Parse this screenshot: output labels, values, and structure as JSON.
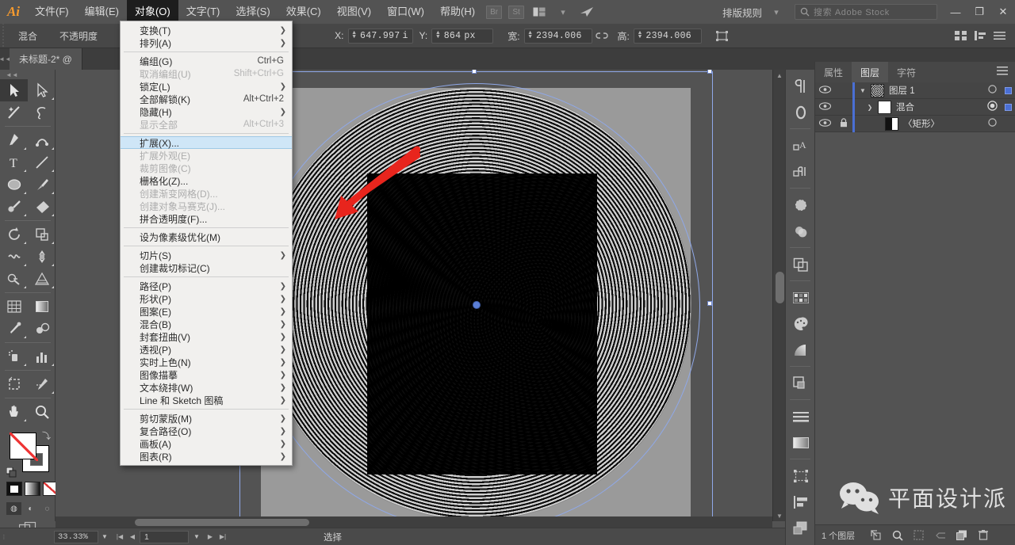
{
  "app": {
    "logo": "Ai"
  },
  "menubar": {
    "items": [
      {
        "label": "文件(F)",
        "active": false
      },
      {
        "label": "编辑(E)",
        "active": false
      },
      {
        "label": "对象(O)",
        "active": true
      },
      {
        "label": "文字(T)",
        "active": false
      },
      {
        "label": "选择(S)",
        "active": false
      },
      {
        "label": "效果(C)",
        "active": false
      },
      {
        "label": "视图(V)",
        "active": false
      },
      {
        "label": "窗口(W)",
        "active": false
      },
      {
        "label": "帮助(H)",
        "active": false
      }
    ],
    "bridge_badge": "Br",
    "stock_badge": "St",
    "arrange_icon": "arrange-documents-icon",
    "share_icon": "share-icon",
    "workspace": "排版规则",
    "search_placeholder": "搜索 Adobe Stock",
    "window_minimize": "—",
    "window_restore": "❐",
    "window_close": "✕"
  },
  "controlbar": {
    "object_type": "混合",
    "opacity_label": "不透明度",
    "x_label": "X:",
    "x_value": "647.997",
    "x_unit": "i",
    "y_label": "Y:",
    "y_value": "864",
    "y_unit": "px",
    "w_label": "宽:",
    "w_value": "2394.006",
    "link_icon": "broken-link-icon",
    "h_label": "高:",
    "h_value": "2394.006",
    "transform_icon": "transform-icon",
    "arrange_icon": "arrange-icon",
    "align_icon": "align-icon",
    "menu_icon": "panel-menu-icon"
  },
  "tabbar": {
    "document_title": "未标题-2* @"
  },
  "menu_dropdown": {
    "items": [
      {
        "label": "变换(T)",
        "key": "",
        "sub": true,
        "disabled": false,
        "highlight": false,
        "sep_after": false
      },
      {
        "label": "排列(A)",
        "key": "",
        "sub": true,
        "disabled": false,
        "highlight": false,
        "sep_after": true
      },
      {
        "label": "编组(G)",
        "key": "Ctrl+G",
        "sub": false,
        "disabled": false,
        "highlight": false,
        "sep_after": false
      },
      {
        "label": "取消编组(U)",
        "key": "Shift+Ctrl+G",
        "sub": false,
        "disabled": true,
        "highlight": false,
        "sep_after": false
      },
      {
        "label": "锁定(L)",
        "key": "",
        "sub": true,
        "disabled": false,
        "highlight": false,
        "sep_after": false
      },
      {
        "label": "全部解锁(K)",
        "key": "Alt+Ctrl+2",
        "sub": false,
        "disabled": false,
        "highlight": false,
        "sep_after": false
      },
      {
        "label": "隐藏(H)",
        "key": "",
        "sub": true,
        "disabled": false,
        "highlight": false,
        "sep_after": false
      },
      {
        "label": "显示全部",
        "key": "Alt+Ctrl+3",
        "sub": false,
        "disabled": true,
        "highlight": false,
        "sep_after": true
      },
      {
        "label": "扩展(X)...",
        "key": "",
        "sub": false,
        "disabled": false,
        "highlight": true,
        "sep_after": false
      },
      {
        "label": "扩展外观(E)",
        "key": "",
        "sub": false,
        "disabled": true,
        "highlight": false,
        "sep_after": false
      },
      {
        "label": "裁剪图像(C)",
        "key": "",
        "sub": false,
        "disabled": true,
        "highlight": false,
        "sep_after": false
      },
      {
        "label": "栅格化(Z)...",
        "key": "",
        "sub": false,
        "disabled": false,
        "highlight": false,
        "sep_after": false
      },
      {
        "label": "创建渐变网格(D)...",
        "key": "",
        "sub": false,
        "disabled": true,
        "highlight": false,
        "sep_after": false
      },
      {
        "label": "创建对象马赛克(J)...",
        "key": "",
        "sub": false,
        "disabled": true,
        "highlight": false,
        "sep_after": false
      },
      {
        "label": "拼合透明度(F)...",
        "key": "",
        "sub": false,
        "disabled": false,
        "highlight": false,
        "sep_after": true
      },
      {
        "label": "设为像素级优化(M)",
        "key": "",
        "sub": false,
        "disabled": false,
        "highlight": false,
        "sep_after": true
      },
      {
        "label": "切片(S)",
        "key": "",
        "sub": true,
        "disabled": false,
        "highlight": false,
        "sep_after": false
      },
      {
        "label": "创建裁切标记(C)",
        "key": "",
        "sub": false,
        "disabled": false,
        "highlight": false,
        "sep_after": true
      },
      {
        "label": "路径(P)",
        "key": "",
        "sub": true,
        "disabled": false,
        "highlight": false,
        "sep_after": false
      },
      {
        "label": "形状(P)",
        "key": "",
        "sub": true,
        "disabled": false,
        "highlight": false,
        "sep_after": false
      },
      {
        "label": "图案(E)",
        "key": "",
        "sub": true,
        "disabled": false,
        "highlight": false,
        "sep_after": false
      },
      {
        "label": "混合(B)",
        "key": "",
        "sub": true,
        "disabled": false,
        "highlight": false,
        "sep_after": false
      },
      {
        "label": "封套扭曲(V)",
        "key": "",
        "sub": true,
        "disabled": false,
        "highlight": false,
        "sep_after": false
      },
      {
        "label": "透视(P)",
        "key": "",
        "sub": true,
        "disabled": false,
        "highlight": false,
        "sep_after": false
      },
      {
        "label": "实时上色(N)",
        "key": "",
        "sub": true,
        "disabled": false,
        "highlight": false,
        "sep_after": false
      },
      {
        "label": "图像描摹",
        "key": "",
        "sub": true,
        "disabled": false,
        "highlight": false,
        "sep_after": false
      },
      {
        "label": "文本绕排(W)",
        "key": "",
        "sub": true,
        "disabled": false,
        "highlight": false,
        "sep_after": false
      },
      {
        "label": "Line 和 Sketch 图稿",
        "key": "",
        "sub": true,
        "disabled": false,
        "highlight": false,
        "sep_after": true
      },
      {
        "label": "剪切蒙版(M)",
        "key": "",
        "sub": true,
        "disabled": false,
        "highlight": false,
        "sep_after": false
      },
      {
        "label": "复合路径(O)",
        "key": "",
        "sub": true,
        "disabled": false,
        "highlight": false,
        "sep_after": false
      },
      {
        "label": "画板(A)",
        "key": "",
        "sub": true,
        "disabled": false,
        "highlight": false,
        "sep_after": false
      },
      {
        "label": "图表(R)",
        "key": "",
        "sub": true,
        "disabled": false,
        "highlight": false,
        "sep_after": false
      }
    ]
  },
  "toolbar": {
    "tools": [
      {
        "name": "selection-tool",
        "selected": true,
        "corner": false
      },
      {
        "name": "direct-selection-tool",
        "selected": false,
        "corner": true
      },
      {
        "name": "magic-wand-tool",
        "selected": false,
        "corner": false
      },
      {
        "name": "lasso-tool",
        "selected": false,
        "corner": false
      },
      {
        "name": "pen-tool",
        "selected": false,
        "corner": true
      },
      {
        "name": "curvature-tool",
        "selected": false,
        "corner": true
      },
      {
        "name": "type-tool",
        "selected": false,
        "corner": true
      },
      {
        "name": "line-segment-tool",
        "selected": false,
        "corner": true
      },
      {
        "name": "ellipse-tool",
        "selected": false,
        "corner": true
      },
      {
        "name": "paintbrush-tool",
        "selected": false,
        "corner": true
      },
      {
        "name": "shaper-tool",
        "selected": false,
        "corner": true
      },
      {
        "name": "eraser-tool",
        "selected": false,
        "corner": true
      },
      {
        "name": "rotate-tool",
        "selected": false,
        "corner": true
      },
      {
        "name": "scale-tool",
        "selected": false,
        "corner": true
      },
      {
        "name": "width-tool",
        "selected": false,
        "corner": true
      },
      {
        "name": "free-transform-tool",
        "selected": false,
        "corner": true
      },
      {
        "name": "shape-builder-tool",
        "selected": false,
        "corner": true
      },
      {
        "name": "perspective-grid-tool",
        "selected": false,
        "corner": true
      },
      {
        "name": "mesh-tool",
        "selected": false,
        "corner": false
      },
      {
        "name": "gradient-tool",
        "selected": false,
        "corner": false
      },
      {
        "name": "eyedropper-tool",
        "selected": false,
        "corner": true
      },
      {
        "name": "blend-tool",
        "selected": false,
        "corner": false
      },
      {
        "name": "symbol-sprayer-tool",
        "selected": false,
        "corner": true
      },
      {
        "name": "column-graph-tool",
        "selected": false,
        "corner": true
      },
      {
        "name": "artboard-tool",
        "selected": false,
        "corner": false
      },
      {
        "name": "slice-tool",
        "selected": false,
        "corner": true
      },
      {
        "name": "hand-tool",
        "selected": false,
        "corner": true
      },
      {
        "name": "zoom-tool",
        "selected": false,
        "corner": false
      }
    ],
    "fill_swatch": "fill-swatch-none",
    "stroke_swatch": "stroke-swatch",
    "swap_icon": "swap-fill-stroke-icon",
    "default_icon": "default-fill-stroke-icon",
    "color_mode": "color-swatch",
    "gradient_mode": "gradient-swatch",
    "none_mode": "none-swatch",
    "draw_normal": "draw-normal-icon",
    "draw_behind": "draw-behind-icon",
    "draw_inside": "draw-inside-icon",
    "screen_mode": "screen-mode-icon"
  },
  "canvas": {
    "artwork_name": "concentric-rings-blend",
    "selection_handles": 8,
    "center_anchor": "center-anchor-point",
    "annotation_arrow": "red-pointer-arrow"
  },
  "statusbar": {
    "zoom_level": "33.33%",
    "page_number": "1",
    "status_text": "选择",
    "first_icon": "first-page-icon",
    "prev_icon": "prev-page-icon",
    "next_icon": "next-page-icon",
    "last_icon": "last-page-icon"
  },
  "rail": {
    "buttons": [
      {
        "name": "paragraph-panel-icon"
      },
      {
        "name": "glyphs-panel-icon"
      },
      {
        "name": "character-styles-panel-icon"
      },
      {
        "name": "paragraph-styles-panel-icon"
      },
      {
        "name": "brushes-panel-icon"
      },
      {
        "name": "symbols-panel-icon"
      },
      {
        "name": "transparency-panel-icon"
      },
      {
        "name": "gradient-panel-icon"
      },
      {
        "name": "image-trace-panel-icon"
      },
      {
        "name": "swatches-panel-icon"
      },
      {
        "name": "color-panel-icon"
      },
      {
        "name": "pathfinder-panel-icon"
      },
      {
        "name": "stroke-panel-icon"
      },
      {
        "name": "appearance-panel-icon"
      },
      {
        "name": "transform-panel-icon"
      },
      {
        "name": "align-panel-icon"
      },
      {
        "name": "layers-stack-icon"
      }
    ]
  },
  "panel": {
    "tabs": [
      {
        "label": "属性",
        "active": false
      },
      {
        "label": "图层",
        "active": true
      },
      {
        "label": "字符",
        "active": false
      }
    ],
    "menu_icon": "panel-options-icon",
    "layers": [
      {
        "name": "图层 1",
        "indent": 0,
        "visible": true,
        "locked": false,
        "expandable": true,
        "expanded": true,
        "thumb": "rings-thumb",
        "selected": false,
        "target_ring": "circle",
        "color_square": true
      },
      {
        "name": "混合",
        "indent": 1,
        "visible": true,
        "locked": false,
        "expandable": true,
        "expanded": false,
        "thumb": "blend-thumb",
        "selected": false,
        "target_ring": "double-circle",
        "color_square": true
      },
      {
        "name": "〈矩形〉",
        "indent": 2,
        "visible": true,
        "locked": true,
        "expandable": false,
        "expanded": false,
        "thumb": "rect-thumb",
        "selected": false,
        "target_ring": "circle",
        "color_square": false
      }
    ],
    "footer_count": "1 个图层",
    "footer_icons": [
      {
        "name": "locate-object-icon",
        "dim": false
      },
      {
        "name": "search-layers-icon",
        "dim": false
      },
      {
        "name": "make-clipping-mask-icon",
        "dim": true
      },
      {
        "name": "create-sublayer-icon",
        "dim": true
      },
      {
        "name": "create-new-layer-icon",
        "dim": false
      },
      {
        "name": "delete-layer-icon",
        "dim": false
      }
    ]
  },
  "watermark": {
    "icon": "wechat-icon",
    "text": "平面设计派"
  }
}
